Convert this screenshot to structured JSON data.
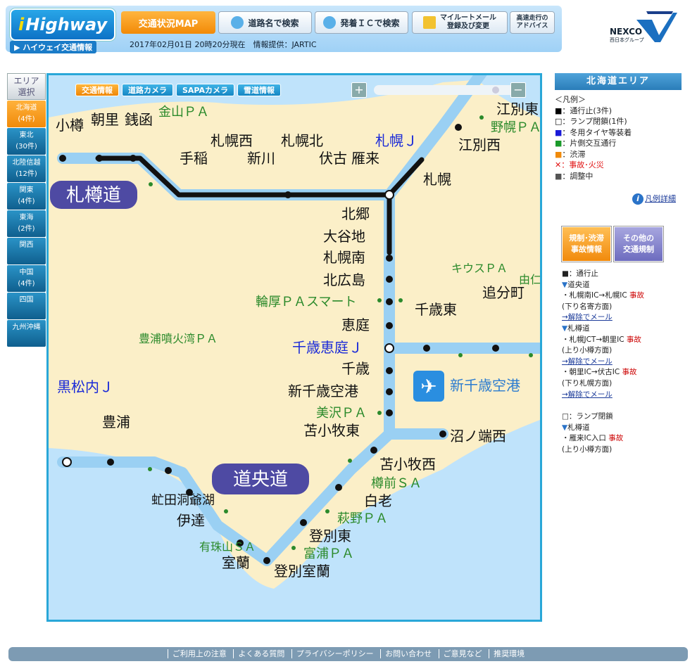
{
  "header": {
    "logo_i": "i",
    "logo_rest": "Highway",
    "logo_sub": "▶ ハイウェイ交通情報",
    "btn_map": "交通状況MAP",
    "btn_name": "道路名で検索",
    "btn_ic": "発着ＩＣで検索",
    "btn_mail_1": "マイルートメール",
    "btn_mail_2": "登録及び変更",
    "btn_adv_1": "高速走行の",
    "btn_adv_2": "アドバイス",
    "update": "2017年02月01日 20時20分現在　情報提供：JARTIC",
    "nexco": "NEXCO",
    "nexco_sub": "西日本グループ"
  },
  "area_selector": {
    "head_1": "エリア",
    "head_2": "選択",
    "items": [
      {
        "name": "北海道",
        "count": "(4件)",
        "active": true
      },
      {
        "name": "東北",
        "count": "(30件)"
      },
      {
        "name": "北陸信越",
        "count": "(12件)"
      },
      {
        "name": "関東",
        "count": "(4件)"
      },
      {
        "name": "東海",
        "count": "(2件)"
      },
      {
        "name": "関西",
        "count": ""
      },
      {
        "name": "中国",
        "count": "(4件)"
      },
      {
        "name": "四国",
        "count": ""
      },
      {
        "name": "九州沖縄",
        "count": ""
      }
    ]
  },
  "map": {
    "tabs": [
      "交通情報",
      "道路カメラ",
      "SAPAカメラ",
      "雪道情報"
    ],
    "zoom_in": "+",
    "zoom_out": "−",
    "roads": [
      "札樽道",
      "道央道"
    ],
    "airport": "新千歳空港",
    "labels_black": [
      "小樽",
      "朝里",
      "銭函",
      "手稲",
      "札幌西",
      "新川",
      "札幌北",
      "伏古",
      "雁来",
      "札幌",
      "江別東",
      "江別西",
      "北郷",
      "大谷地",
      "札幌南",
      "北広島",
      "恵庭",
      "千歳",
      "新千歳空港",
      "苫小牧東",
      "沼ノ端西",
      "苫小牧西",
      "白老",
      "登別東",
      "登別室蘭",
      "室蘭",
      "伊達",
      "虻田洞爺湖",
      "豊浦",
      "千歳東",
      "追分町"
    ],
    "labels_green": [
      "金山ＰＡ",
      "野幌ＰＡ",
      "輪厚ＰＡスマート",
      "美沢ＰＡ",
      "樽前ＳＡ",
      "萩野ＰＡ",
      "富浦ＰＡ",
      "有珠山ＳＡ",
      "豊浦噴火湾ＰＡ",
      "キウスＰＡ",
      "由仁ＰＡ"
    ],
    "labels_blue": [
      "札幌Ｊ",
      "千歳恵庭Ｊ",
      "黒松内Ｊ"
    ]
  },
  "right": {
    "area_title": "北海道エリア",
    "legend_title": "＜凡例＞",
    "legend": [
      {
        "mark": "■",
        "text": "：通行止(3件)",
        "color": "#000000"
      },
      {
        "mark": "□",
        "text": "：ランプ閉鎖(1件)",
        "color": "#000000"
      },
      {
        "mark": "■",
        "text": "：冬用タイヤ等装着",
        "color": "#1a1ad8"
      },
      {
        "mark": "■",
        "text": "：片側交互通行",
        "color": "#1a9a2a"
      },
      {
        "mark": "■",
        "text": "：渋滞",
        "color": "#f08a0a"
      },
      {
        "mark": "✕",
        "text": "：事故･火災",
        "color": "#e01010"
      },
      {
        "mark": "■",
        "text": "：調整中",
        "color": "#555555"
      }
    ],
    "legend_link": "凡例詳細",
    "btn_reg_1": "規制･渋滞",
    "btn_reg_2": "事故情報",
    "btn_other_1": "その他の",
    "btn_other_2": "交通規制",
    "closure_title": "■：通行止",
    "closures": [
      {
        "road": "道央道",
        "section": "・札幌南IC→札幌IC",
        "kind": "事故",
        "dir": "(下り名寄方面)",
        "link": "→解除でメール"
      },
      {
        "road": "札樽道",
        "section": "・札幌JCT→朝里IC",
        "kind": "事故",
        "dir": "(上り小樽方面)",
        "link": "→解除でメール"
      },
      {
        "road": "",
        "section": "・朝里IC→伏古IC",
        "kind": "事故",
        "dir": "(下り札幌方面)",
        "link": "→解除でメール"
      }
    ],
    "ramp_title": "□：ランプ閉鎖",
    "ramp": {
      "road": "札樽道",
      "section": "・雁来IC入口",
      "kind": "事故",
      "dir": "(上り小樽方面)"
    }
  },
  "footer": [
    "ご利用上の注意",
    "よくある質問",
    "プライバシーポリシー",
    "お問い合わせ",
    "ご意見など",
    "推奨環境"
  ]
}
